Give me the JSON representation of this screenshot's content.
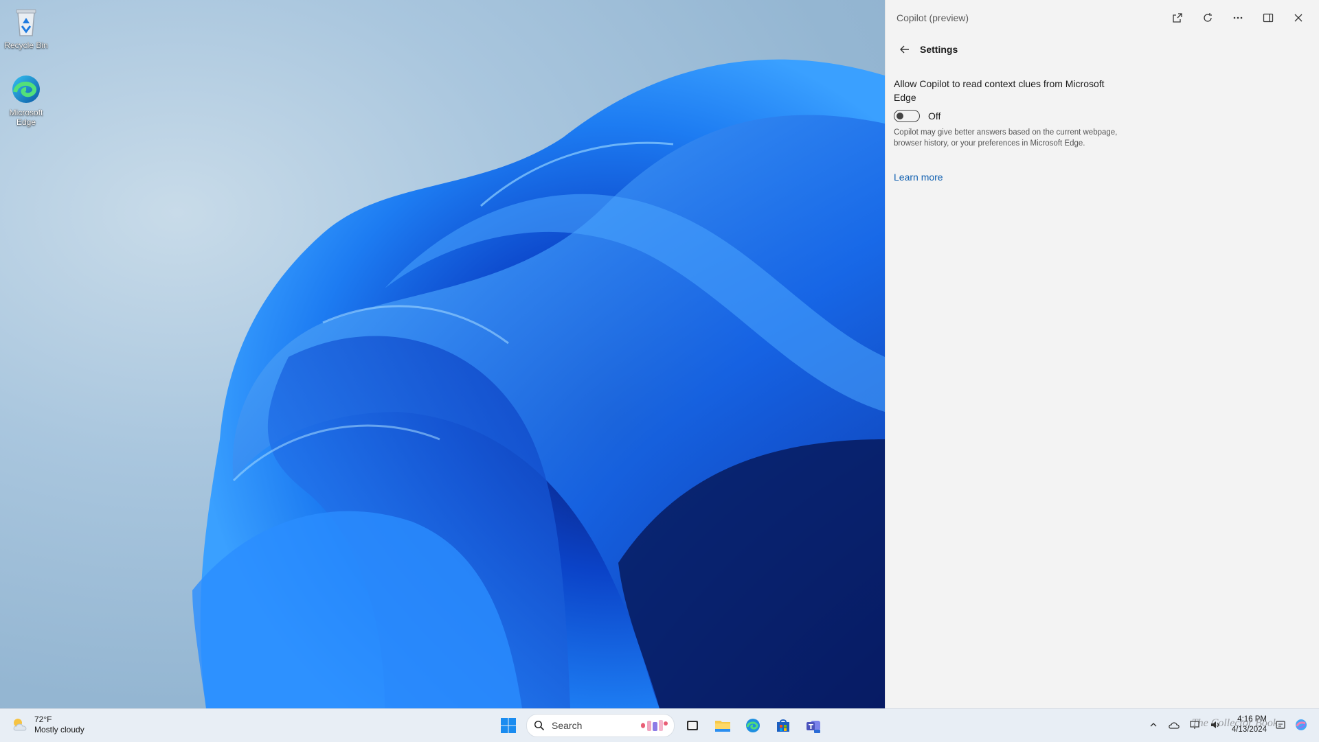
{
  "desktop": {
    "icons": [
      {
        "label": "Recycle Bin"
      },
      {
        "label": "Microsoft Edge"
      }
    ]
  },
  "copilot": {
    "title": "Copilot (preview)",
    "controls": [
      "open-in-new-icon",
      "refresh-icon",
      "more-icon",
      "split-view-icon",
      "close-icon"
    ],
    "settings": {
      "heading": "Settings",
      "option_label": "Allow Copilot to read context clues from Microsoft Edge",
      "toggle_state": "Off",
      "description": "Copilot may give better answers based on the current webpage, browser history, or your preferences in Microsoft Edge.",
      "learn_more": "Learn more"
    }
  },
  "taskbar": {
    "weather": {
      "temp": "72°F",
      "condition": "Mostly cloudy"
    },
    "search": {
      "placeholder": "Search"
    },
    "apps": [
      "start-icon",
      "search-icon",
      "task-view-icon",
      "file-explorer-icon",
      "edge-icon",
      "store-icon",
      "teams-icon"
    ],
    "clock": {
      "time": "4:16 PM",
      "date": "4/13/2024"
    },
    "watermark": "The Collector Book"
  },
  "colors": {
    "accent": "#0f5fb0",
    "panel_bg": "#f3f3f3",
    "taskbar_bg": "#e8eef5"
  }
}
